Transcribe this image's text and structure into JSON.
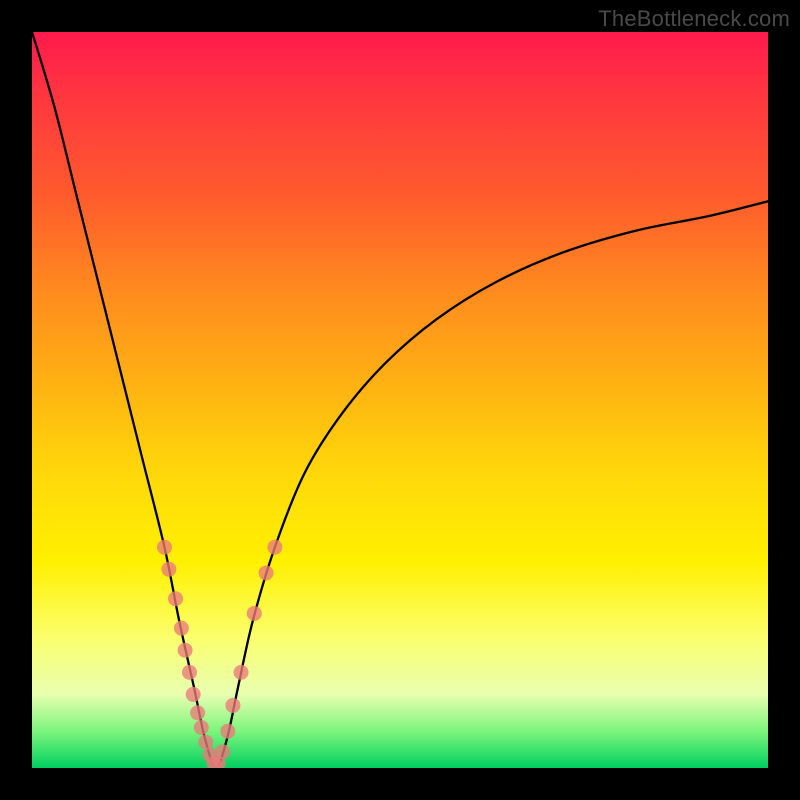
{
  "watermark": "TheBottleneck.com",
  "chart_data": {
    "type": "line",
    "title": "",
    "xlabel": "",
    "ylabel": "",
    "xlim": [
      0,
      100
    ],
    "ylim": [
      0,
      100
    ],
    "annotations": [
      "TheBottleneck.com"
    ],
    "comment": "V-shaped bottleneck curve over rainbow gradient (red=top=high bottleneck, green=bottom=0%). No axes/ticks rendered. Values are estimated from pixel positions; minimum ~0 at x≈25.",
    "series": [
      {
        "name": "bottleneck-curve",
        "x": [
          0,
          3,
          6,
          9,
          12,
          15,
          18,
          20,
          22,
          23.5,
          25,
          26.5,
          28,
          30,
          33,
          37,
          42,
          48,
          55,
          63,
          72,
          82,
          92,
          100
        ],
        "y": [
          100,
          90,
          78,
          66,
          54,
          42,
          30,
          20,
          11,
          4,
          0,
          4,
          11,
          20,
          30,
          40,
          48,
          55,
          61,
          66,
          70,
          73,
          75,
          77
        ]
      },
      {
        "name": "sample-dots-left",
        "x": [
          18.0,
          18.6,
          19.5,
          20.3,
          20.8,
          21.4,
          21.9,
          22.5,
          23.0,
          23.6,
          24.2,
          24.7
        ],
        "y": [
          30,
          27,
          23,
          19,
          16,
          13,
          10,
          7.5,
          5.5,
          3.5,
          1.8,
          0.6
        ]
      },
      {
        "name": "sample-dots-right",
        "x": [
          25.3,
          25.9,
          26.6,
          27.3,
          28.4,
          30.2,
          31.8,
          33.0
        ],
        "y": [
          0.6,
          2.2,
          5.0,
          8.5,
          13.0,
          21.0,
          26.5,
          30.0
        ]
      }
    ],
    "gradient_stops": [
      {
        "pct": 0,
        "color": "#ff1a4d"
      },
      {
        "pct": 10,
        "color": "#ff3a3d"
      },
      {
        "pct": 22,
        "color": "#ff5a2d"
      },
      {
        "pct": 35,
        "color": "#ff8a1f"
      },
      {
        "pct": 48,
        "color": "#ffb212"
      },
      {
        "pct": 60,
        "color": "#ffd80a"
      },
      {
        "pct": 72,
        "color": "#fff000"
      },
      {
        "pct": 82,
        "color": "#fbff6a"
      },
      {
        "pct": 90,
        "color": "#e8ffb0"
      },
      {
        "pct": 95,
        "color": "#7cf57c"
      },
      {
        "pct": 100,
        "color": "#00d060"
      }
    ]
  }
}
